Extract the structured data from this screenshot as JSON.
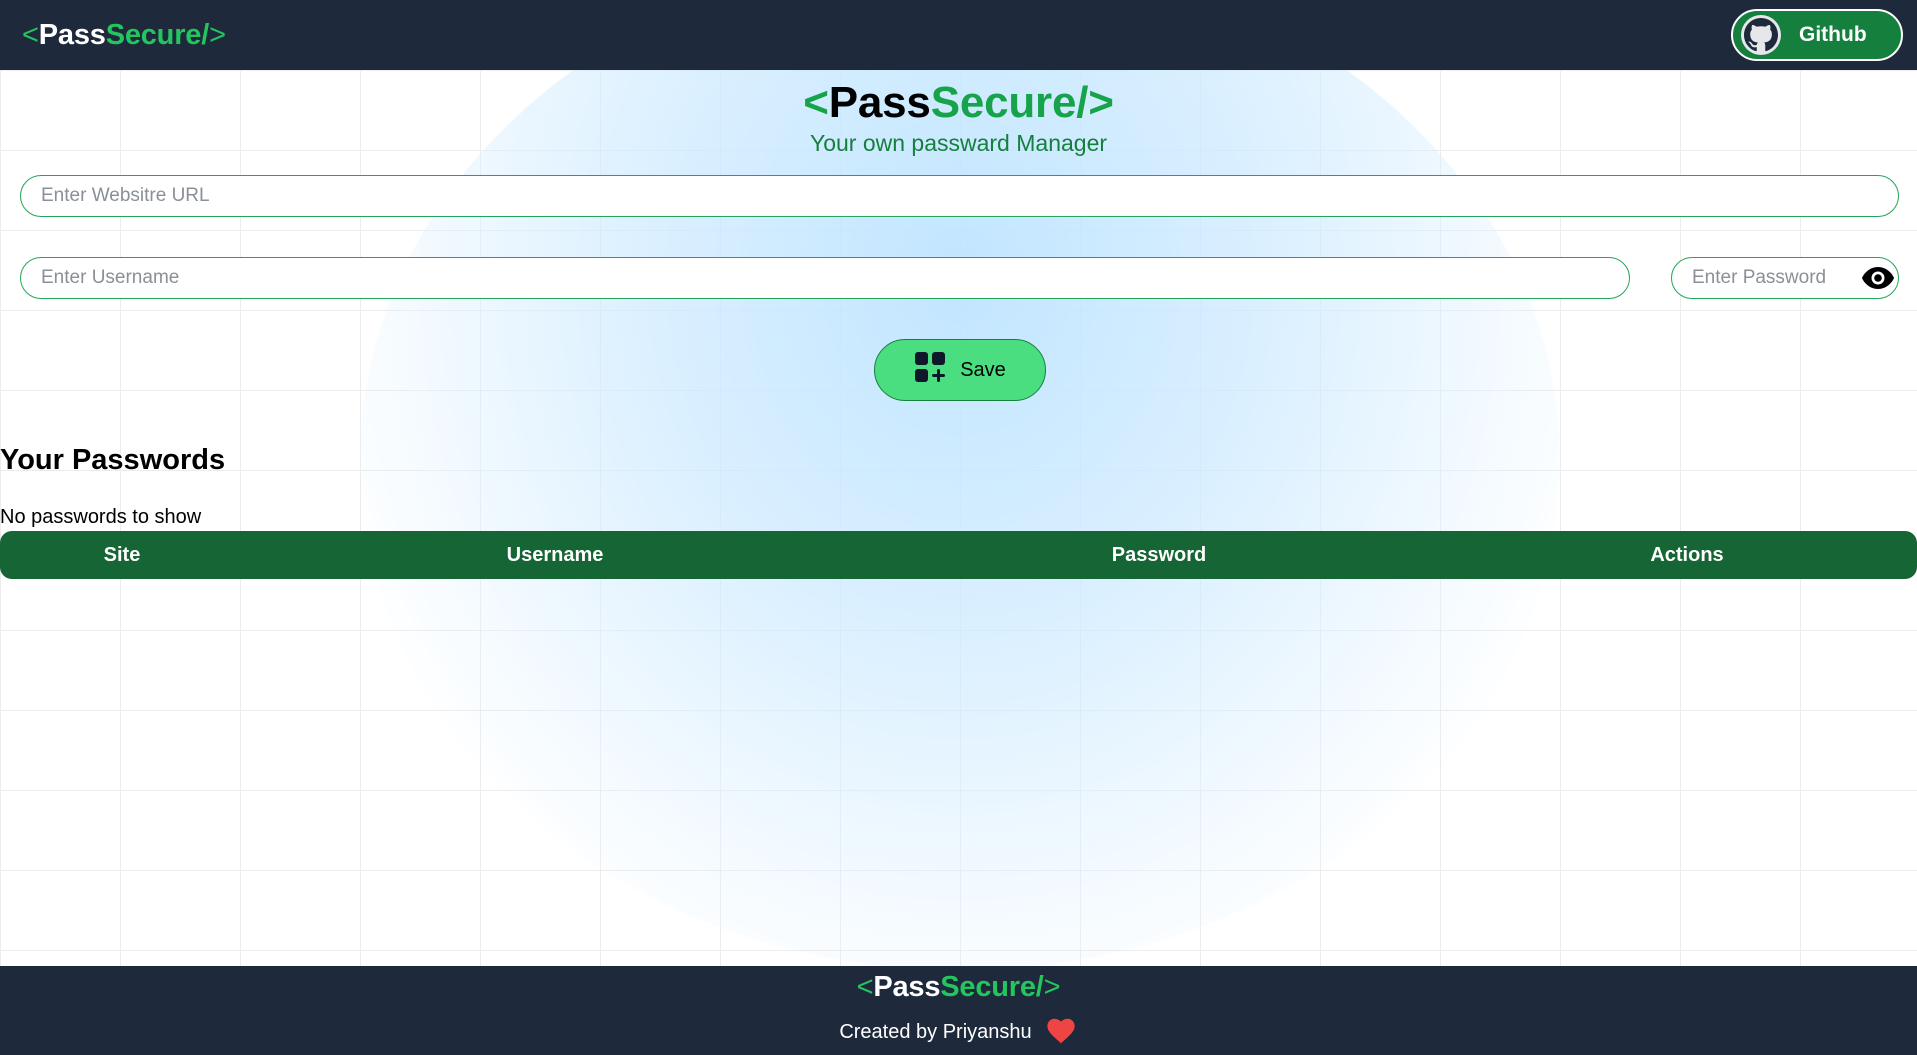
{
  "brand": {
    "open": "<",
    "pass": "Pass",
    "secure": "Secure/",
    "close": ">"
  },
  "navbar": {
    "github_label": "Github"
  },
  "hero": {
    "subtitle": "Your own passward Manager"
  },
  "form": {
    "url_placeholder": "Enter Websitre URL",
    "username_placeholder": "Enter Username",
    "password_placeholder": "Enter Password",
    "save_label": "Save"
  },
  "passwords": {
    "title": "Your Passwords",
    "empty_text": "No passwords to show",
    "columns": [
      "Site",
      "Username",
      "Password",
      "Actions"
    ]
  },
  "footer": {
    "credit": "Created by Priyanshu"
  },
  "colors": {
    "navbar_bg": "#1e293b",
    "accent": "#22c55e",
    "table_header": "#166534",
    "save_button": "#4ade80",
    "heart": "#ef4444"
  },
  "icons": [
    "github-icon",
    "eye-icon",
    "add-grid-icon",
    "heart-icon"
  ]
}
